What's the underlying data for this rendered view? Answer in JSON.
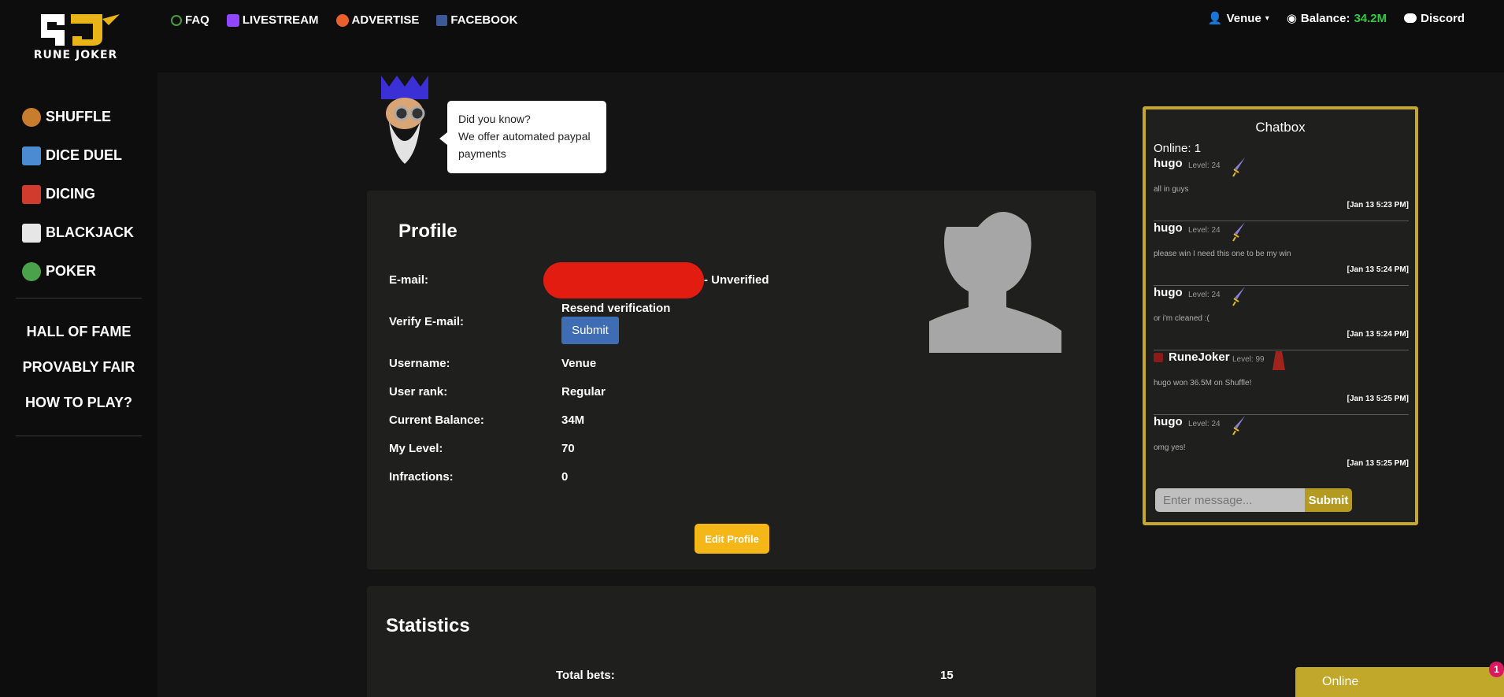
{
  "brand": {
    "logo_text": "RUNE JOKER"
  },
  "topnav": [
    {
      "label": "FAQ",
      "icon": "faq-icon"
    },
    {
      "label": "LIVESTREAM",
      "icon": "twitch-icon"
    },
    {
      "label": "ADVERTISE",
      "icon": "megaphone-icon"
    },
    {
      "label": "FACEBOOK",
      "icon": "facebook-icon"
    }
  ],
  "topright": {
    "user_label": "Venue",
    "balance_label": "Balance:",
    "balance_value": "34.2M",
    "discord_label": "Discord"
  },
  "sidebar": {
    "games": [
      {
        "label": "SHUFFLE",
        "color": "#c87d2e"
      },
      {
        "label": "DICE DUEL",
        "color": "#4a8bd1"
      },
      {
        "label": "DICING",
        "color": "#d13b2e"
      },
      {
        "label": "BLACKJACK",
        "color": "#e6e6e6"
      },
      {
        "label": "POKER",
        "color": "#4aa34a"
      }
    ],
    "links": [
      "HALL OF FAME",
      "PROVABLY FAIR",
      "HOW TO PLAY?"
    ]
  },
  "tip": {
    "title": "Did you know?",
    "text": "We offer automated paypal payments"
  },
  "profile": {
    "title": "Profile",
    "email_label": "E-mail:",
    "email_status": "- Unverified",
    "verify_label": "Verify E-mail:",
    "resend_label": "Resend verification",
    "submit_label": "Submit",
    "username_label": "Username:",
    "username_value": "Venue",
    "rank_label": "User rank:",
    "rank_value": "Regular",
    "balance_label": "Current Balance:",
    "balance_value": "34M",
    "level_label": "My Level:",
    "level_value": "70",
    "infractions_label": "Infractions:",
    "infractions_value": "0",
    "edit_label": "Edit Profile"
  },
  "statistics": {
    "title": "Statistics",
    "total_bets_label": "Total bets:",
    "total_bets_value": "15"
  },
  "chat": {
    "title": "Chatbox",
    "online": "Online: 1",
    "messages": [
      {
        "user": "hugo",
        "level": "Level: 24",
        "text": "all in guys",
        "time": "[Jan 13 5:23 PM]"
      },
      {
        "user": "hugo",
        "level": "Level: 24",
        "text": "please win I need this one to be my win",
        "time": "[Jan 13 5:24 PM]"
      },
      {
        "user": "hugo",
        "level": "Level: 24",
        "text": "or i'm cleaned :(",
        "time": "[Jan 13 5:24 PM]"
      },
      {
        "user": "RuneJoker",
        "level": "Level: 99",
        "text": "hugo won 36.5M on Shuffle!",
        "time": "[Jan 13 5:25 PM]"
      },
      {
        "user": "hugo",
        "level": "Level: 24",
        "text": "omg yes!",
        "time": "[Jan 13 5:25 PM]"
      }
    ],
    "input_placeholder": "Enter message...",
    "submit_label": "Submit"
  },
  "online_widget": {
    "label": "Online",
    "badge": "1"
  }
}
